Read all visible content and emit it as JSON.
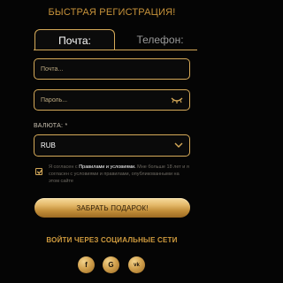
{
  "form": {
    "title": "БЫСТРАЯ РЕГИСТРАЦИЯ!",
    "tabs": [
      {
        "label": "Почта:",
        "active": true
      },
      {
        "label": "Телефон:",
        "active": false
      }
    ],
    "email_placeholder": "Почта...",
    "password_placeholder": "Пароль...",
    "currency_label": "ВАЛЮТА: *",
    "currency_value": "RUB",
    "terms": {
      "part1": "Я согласен с ",
      "link": "Правилами и условиями.",
      "part2": " Мне больше 18 лет и я согласен с условиями и правилами, опубликованными на этом сайте",
      "checked": true
    },
    "submit_label": "ЗАБРАТЬ ПОДАРОК!",
    "social_title": "ВОЙТИ ЧЕРЕЗ СОЦИАЛЬНЫЕ СЕТИ",
    "social": [
      {
        "icon": "facebook-icon",
        "glyph": "f"
      },
      {
        "icon": "google-icon",
        "glyph": "G"
      },
      {
        "icon": "vk-icon",
        "glyph": "vk"
      }
    ]
  },
  "colors": {
    "accent": "#d6aa59",
    "background": "#050505",
    "title": "#c6923a"
  }
}
